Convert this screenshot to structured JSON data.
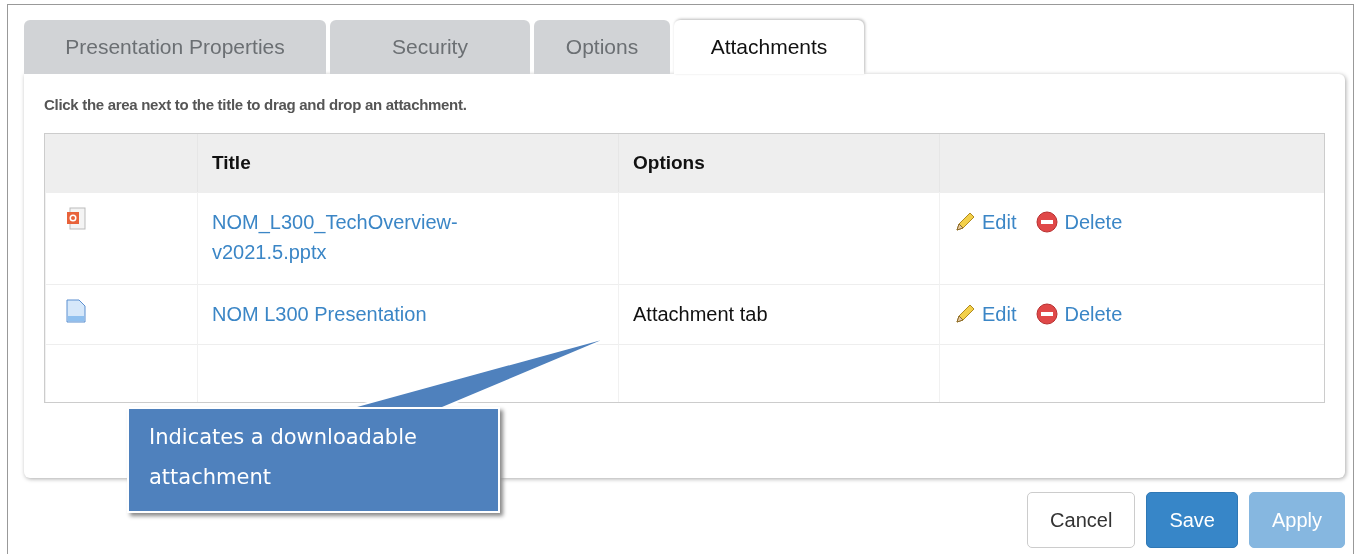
{
  "tabs": [
    {
      "label": "Presentation Properties",
      "selected": false
    },
    {
      "label": "Security",
      "selected": false
    },
    {
      "label": "Options",
      "selected": false
    },
    {
      "label": "Attachments",
      "selected": true
    }
  ],
  "instruction": "Click the area next to the title to drag and drop an attachment.",
  "table": {
    "columns": [
      "Title",
      "Options"
    ],
    "rows": [
      {
        "kind": "powerpoint",
        "title": "NOM_L300_TechOverview-v2021.5.pptx",
        "actions": [
          {
            "kind": "edit",
            "label": "Edit"
          },
          {
            "kind": "delete",
            "label": "Delete"
          }
        ]
      },
      {
        "kind": "document",
        "title": "NOM L300  Presentation",
        "options": "Attachment tab",
        "actions": [
          {
            "kind": "edit",
            "label": "Edit"
          },
          {
            "kind": "delete",
            "label": "Delete"
          }
        ]
      }
    ]
  },
  "callout": {
    "text": "Indicates a downloadable attachment"
  },
  "buttons": [
    {
      "label": "Cancel",
      "kind": "default",
      "disabled": false
    },
    {
      "label": "Save",
      "kind": "primary",
      "disabled": false
    },
    {
      "label": "Apply",
      "kind": "primary",
      "disabled": true
    }
  ]
}
